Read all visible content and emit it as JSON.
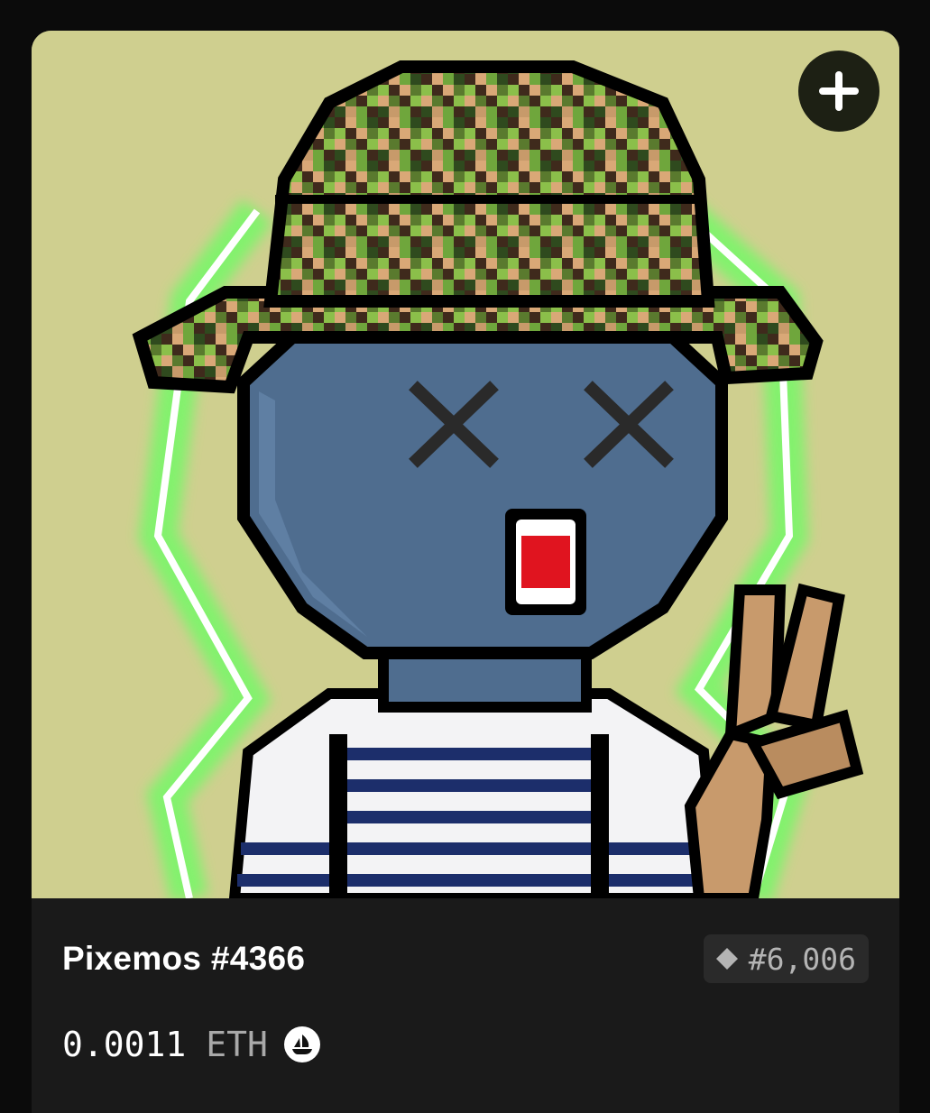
{
  "card": {
    "name": "Pixemos #4366",
    "rank": "#6,006",
    "price": "0.0011",
    "currency": "ETH",
    "icons": {
      "add": "plus-icon",
      "rank": "diamond-icon",
      "marketplace": "opensea-icon"
    }
  },
  "colors": {
    "art_background": "#cfcf8f",
    "face": "#4f6d8f",
    "glow": "#7cf56a",
    "card_background": "#1a1a1a"
  }
}
